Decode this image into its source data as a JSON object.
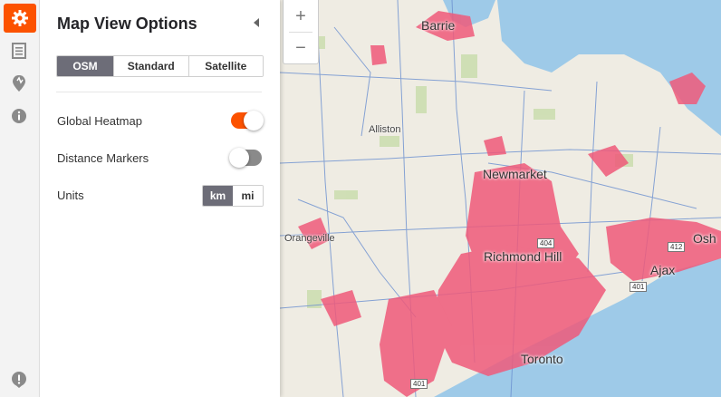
{
  "rail": {
    "items": [
      {
        "icon": "gear-icon",
        "active": true
      },
      {
        "icon": "document-icon",
        "active": false
      },
      {
        "icon": "route-icon",
        "active": false
      },
      {
        "icon": "info-icon",
        "active": false
      },
      {
        "icon": "feedback-icon",
        "active": false
      }
    ]
  },
  "panel": {
    "title": "Map View Options",
    "map_types": [
      "OSM",
      "Standard",
      "Satellite"
    ],
    "selected_map_type": "OSM",
    "global_heatmap_label": "Global Heatmap",
    "global_heatmap_on": true,
    "distance_markers_label": "Distance Markers",
    "distance_markers_on": false,
    "units_label": "Units",
    "units": [
      "km",
      "mi"
    ],
    "selected_unit": "km"
  },
  "map": {
    "zoom_in": "+",
    "zoom_out": "−",
    "places": {
      "barrie": "Barrie",
      "alliston": "Alliston",
      "newmarket": "Newmarket",
      "orangeville": "Orangeville",
      "richmond_hill": "Richmond Hill",
      "ajax": "Ajax",
      "oshawa": "Osh",
      "toronto": "Toronto"
    },
    "shields": {
      "r404": "404",
      "r412": "412",
      "r401": "401",
      "r401b": "401"
    }
  },
  "colors": {
    "accent": "#fc5200",
    "water": "#9ecae8",
    "heat": "#ef5a7a",
    "route": "#6a8fd0"
  }
}
